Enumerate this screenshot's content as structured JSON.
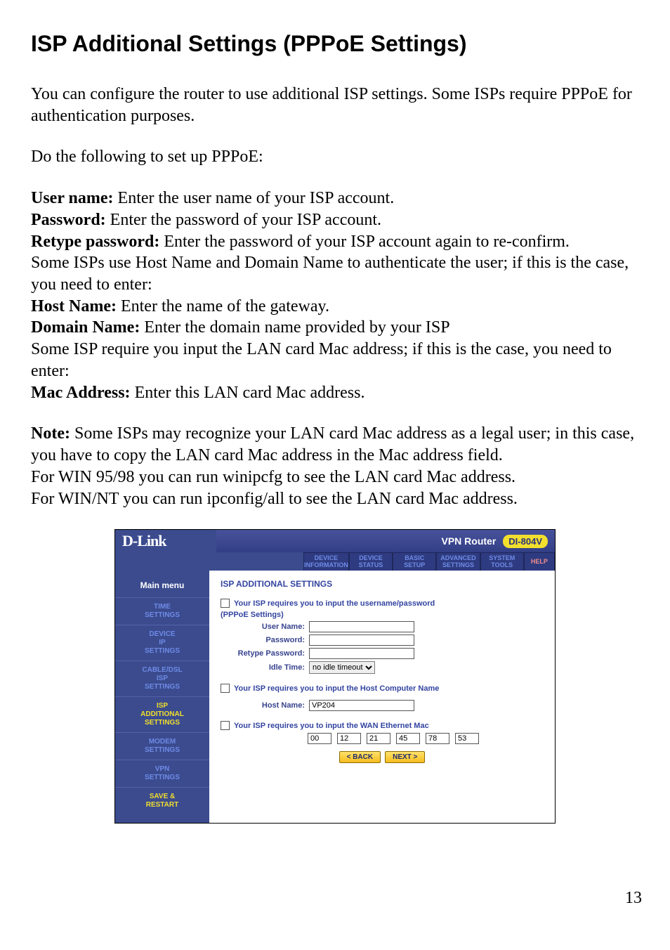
{
  "doc": {
    "title": "ISP Additional Settings (PPPoE Settings)",
    "intro": "You can configure the router to use additional ISP settings. Some ISPs require PPPoE for authentication purposes.",
    "lead": "Do the following to set up PPPoE:",
    "fields": {
      "user_name": {
        "label": "User name:",
        "text": " Enter the user name of your ISP account."
      },
      "password": {
        "label": "Password:",
        "text": " Enter the password of your ISP account."
      },
      "retype": {
        "label": "Retype password:",
        "text": " Enter the password of your ISP account again to re-confirm."
      },
      "host_intro": "Some ISPs use Host Name and Domain Name to authenticate the user; if this is the case, you need to enter:",
      "host_name": {
        "label": "Host Name:",
        "text": " Enter the name of the gateway."
      },
      "domain": {
        "label": "Domain Name:",
        "text": " Enter the domain name provided by your ISP"
      },
      "mac_intro": "Some ISP require you input the LAN card Mac address; if this is the case, you need to enter:",
      "mac": {
        "label": "Mac Address:",
        "text": " Enter this LAN card Mac address."
      }
    },
    "note": {
      "label": "Note:",
      "text": " Some ISPs may recognize your LAN card Mac address as a legal user; in this case, you have to copy the LAN card Mac address in the Mac address field."
    },
    "win9598": "For WIN 95/98 you can run winipcfg to see the LAN card Mac address.",
    "winnt": "For WIN/NT you can run ipconfig/all to see the LAN card Mac address.",
    "page_number": "13"
  },
  "ui": {
    "brand": "D-Link",
    "product": "VPN Router",
    "model": "DI-804V",
    "tabs": [
      "DEVICE INFORMATION",
      "DEVICE STATUS",
      "BASIC SETUP",
      "ADVANCED SETTINGS",
      "SYSTEM TOOLS",
      "HELP"
    ],
    "side_header": "Main menu",
    "side_items": [
      "TIME SETTINGS",
      "DEVICE IP SETTINGS",
      "CABLE/DSL ISP SETTINGS",
      "ISP ADDITIONAL SETTINGS",
      "MODEM SETTINGS",
      "VPN SETTINGS",
      "SAVE & RESTART"
    ],
    "side_active_index": 3,
    "section_title": "ISP ADDITIONAL SETTINGS",
    "check_userpass": "Your ISP requires you to input the username/password",
    "pppoe_sub": "(PPPoE Settings)",
    "labels": {
      "user": "User Name:",
      "pass": "Password:",
      "repass": "Retype Password:",
      "idle": "Idle Time:",
      "host": "Host Name:"
    },
    "idle_option": "no idle timeout",
    "check_host": "Your ISP requires you to input the Host Computer Name",
    "host_value": "VP204",
    "check_mac": "Your ISP requires you to input the WAN Ethernet Mac",
    "mac_values": [
      "00",
      "12",
      "21",
      "45",
      "78",
      "53"
    ],
    "btn_back": "< BACK",
    "btn_next": "NEXT >"
  }
}
